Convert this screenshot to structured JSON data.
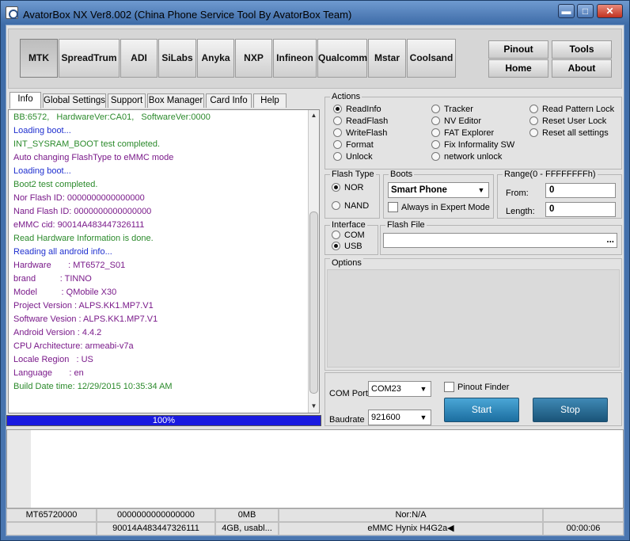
{
  "window": {
    "title": "AvatorBox NX Ver8.002 (China Phone Service Tool By AvatorBox Team)",
    "controls": {
      "minimize": "▬",
      "maximize": "□",
      "close": "✕"
    }
  },
  "platforms": [
    "MTK",
    "SpreadTrum",
    "ADI",
    "SiLabs",
    "Anyka",
    "NXP",
    "Infineon",
    "Qualcomm",
    "Mstar",
    "Coolsand"
  ],
  "nav": {
    "pinout": "Pinout",
    "tools": "Tools",
    "home": "Home",
    "about": "About"
  },
  "tabs": [
    "Info",
    "Global Settings",
    "Support",
    "Box Manager",
    "Card Info",
    "Help"
  ],
  "log": [
    {
      "text": "BB:6572,   HardwareVer:CA01,   SoftwareVer:0000",
      "color": "green"
    },
    {
      "text": "Loading boot...",
      "color": "blue"
    },
    {
      "text": "INT_SYSRAM_BOOT test completed.",
      "color": "green"
    },
    {
      "text": "Auto changing FlashType to eMMC mode",
      "color": "purple"
    },
    {
      "text": "Loading boot...",
      "color": "blue"
    },
    {
      "text": "Boot2 test completed.",
      "color": "green"
    },
    {
      "text": "Nor Flash ID: 0000000000000000",
      "color": "purple"
    },
    {
      "text": "Nand Flash ID: 0000000000000000",
      "color": "purple"
    },
    {
      "text": "eMMC cid: 90014A483447326111",
      "color": "purple"
    },
    {
      "text": "Read Hardware Information is done.",
      "color": "green"
    },
    {
      "text": "Reading all android info...",
      "color": "blue"
    },
    {
      "text": "Hardware       : MT6572_S01",
      "color": "purple"
    },
    {
      "text": "brand          : TINNO",
      "color": "purple"
    },
    {
      "text": "Model          : QMobile X30",
      "color": "purple"
    },
    {
      "text": "Project Version : ALPS.KK1.MP7.V1",
      "color": "purple"
    },
    {
      "text": "Software Vesion : ALPS.KK1.MP7.V1",
      "color": "purple"
    },
    {
      "text": "Android Version : 4.4.2",
      "color": "purple"
    },
    {
      "text": "CPU Architecture: armeabi-v7a",
      "color": "purple"
    },
    {
      "text": "Locale Region   : US",
      "color": "purple"
    },
    {
      "text": "Language       : en",
      "color": "purple"
    },
    {
      "text": "Build Date time: 12/29/2015 10:35:34 AM",
      "color": "green"
    }
  ],
  "progress": {
    "label": "100%",
    "value": 100
  },
  "actions": {
    "label": "Actions",
    "col1": [
      "ReadInfo",
      "ReadFlash",
      "WriteFlash",
      "Format",
      "Unlock"
    ],
    "col2": [
      "Tracker",
      "NV Editor",
      "FAT Explorer",
      "Fix Informality SW",
      "network unlock"
    ],
    "col3": [
      "Read Pattern Lock",
      "Reset User Lock",
      "Reset all settings"
    ],
    "selected": "ReadInfo"
  },
  "flash_type": {
    "label": "Flash Type",
    "options": [
      "NOR",
      "NAND"
    ],
    "selected": "NOR"
  },
  "boots": {
    "label": "Boots",
    "value": "Smart Phone",
    "expert_label": "Always in Expert Mode"
  },
  "range": {
    "label": "Range(0 - FFFFFFFFh)",
    "from_label": "From:",
    "from_value": "0",
    "length_label": "Length:",
    "length_value": "0"
  },
  "interface": {
    "label": "Interface",
    "options": [
      "COM",
      "USB"
    ],
    "selected": "USB"
  },
  "flash_file": {
    "label": "Flash File",
    "browse": "..."
  },
  "options_label": "Options",
  "com_port": {
    "label": "COM Port",
    "value": "COM23"
  },
  "baudrate": {
    "label": "Baudrate",
    "value": "921600"
  },
  "pinout_finder": "Pinout Finder",
  "buttons": {
    "start": "Start",
    "stop": "Stop"
  },
  "status": {
    "row1": [
      "MT65720000",
      "0000000000000000",
      "0MB",
      "Nor:N/A",
      ""
    ],
    "row2": [
      "",
      "90014A483447326111",
      "4GB,  usabl...",
      "eMMC  Hynix  H4G2a◀",
      "00:00:06"
    ]
  },
  "colors": {
    "green": "#2b8a2b",
    "blue": "#1f2fcf",
    "purple": "#7a1a8a",
    "progress": "#1a1ae0"
  }
}
